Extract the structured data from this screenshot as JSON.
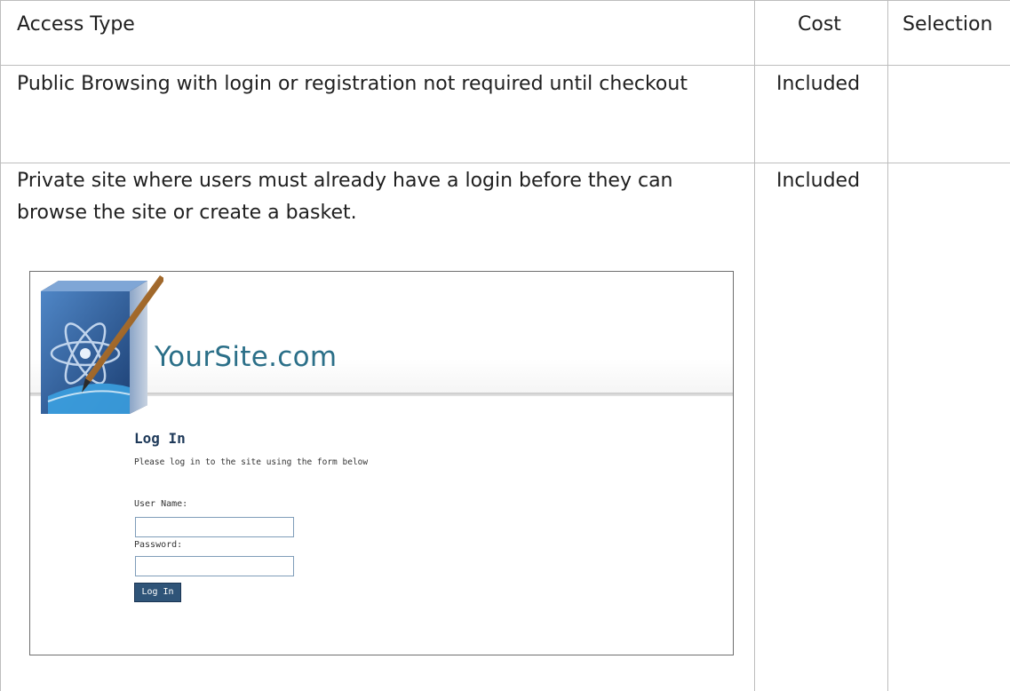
{
  "table": {
    "headers": {
      "access_type": "Access Type",
      "cost": "Cost",
      "selection": "Selection"
    },
    "rows": [
      {
        "access_type": "Public Browsing with login or registration not required until checkout",
        "cost": "Included",
        "selection": ""
      },
      {
        "access_type": "Private site where users must already have a login before they can browse the site or create a basket.",
        "cost": "Included",
        "selection": ""
      }
    ]
  },
  "login_screenshot": {
    "site_name": "YourSite.com",
    "logo_icon": "atom-pen-logo-icon",
    "title": "Log In",
    "instructions": "Please log in to the site using the form below",
    "username_label": "User Name:",
    "password_label": "Password:",
    "username_value": "",
    "password_value": "",
    "button_label": "Log In",
    "colors": {
      "site_name": "#2b6f88",
      "title": "#1f3a5a",
      "button_bg": "#2f5478",
      "logo_blue": "#2a5e9c"
    }
  }
}
